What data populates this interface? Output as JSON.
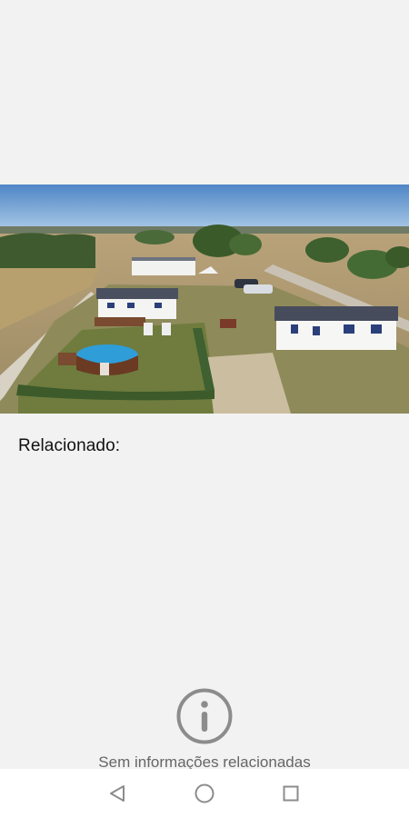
{
  "related": {
    "title": "Relacionado:",
    "empty_message": "Sem informações relacionadas"
  },
  "photo": {
    "alt": "Foto aérea"
  },
  "icons": {
    "info": "info-circle-icon",
    "back": "back-triangle-icon",
    "home": "home-circle-icon",
    "recents": "recents-square-icon"
  },
  "colors": {
    "background": "#f2f2f2",
    "navbar": "#ffffff",
    "icon_gray": "#8c8c8c",
    "text_dark": "#111111",
    "text_muted": "#666666"
  }
}
